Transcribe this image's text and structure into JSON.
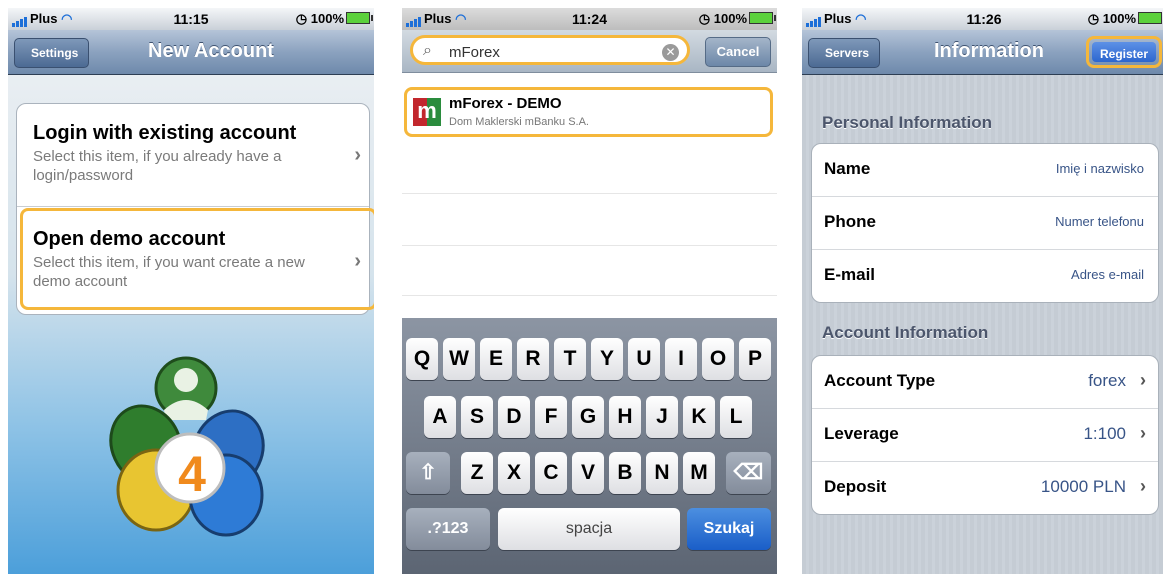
{
  "status_bars": [
    {
      "carrier": "Plus",
      "time": "11:15",
      "battery": "100%"
    },
    {
      "carrier": "Plus",
      "time": "11:24",
      "battery": "100%"
    },
    {
      "carrier": "Plus",
      "time": "11:26",
      "battery": "100%"
    }
  ],
  "screen1": {
    "back_label": "Settings",
    "title": "New Account",
    "options": [
      {
        "title": "Login with existing account",
        "subtitle": "Select this item, if you already have a login/password"
      },
      {
        "title": "Open demo account",
        "subtitle": "Select this item, if you want create a new demo account"
      }
    ],
    "logo_number": "4"
  },
  "screen2": {
    "search_value": "mForex",
    "cancel_label": "Cancel",
    "result": {
      "name": "mForex - DEMO",
      "subtitle": "Dom Maklerski mBanku S.A.",
      "logo_letter": "m"
    },
    "keyboard": {
      "row1": [
        "Q",
        "W",
        "E",
        "R",
        "T",
        "Y",
        "U",
        "I",
        "O",
        "P"
      ],
      "row2": [
        "A",
        "S",
        "D",
        "F",
        "G",
        "H",
        "J",
        "K",
        "L"
      ],
      "row3": [
        "Z",
        "X",
        "C",
        "V",
        "B",
        "N",
        "M"
      ],
      "numbers_key": ".?123",
      "space_key": "spacja",
      "search_key": "Szukaj"
    }
  },
  "screen3": {
    "back_label": "Servers",
    "title": "Information",
    "register_label": "Register",
    "personal_header": "Personal Information",
    "personal_fields": [
      {
        "label": "Name",
        "placeholder": "Imię i nazwisko"
      },
      {
        "label": "Phone",
        "placeholder": "Numer telefonu"
      },
      {
        "label": "E-mail",
        "placeholder": "Adres e-mail"
      }
    ],
    "account_header": "Account Information",
    "account_fields": [
      {
        "label": "Account Type",
        "value": "forex"
      },
      {
        "label": "Leverage",
        "value": "1:100"
      },
      {
        "label": "Deposit",
        "value": "10000 PLN"
      }
    ]
  },
  "colors": {
    "highlight": "#f5b73b",
    "navbar": "#6e89ab",
    "link_value": "#385487"
  }
}
